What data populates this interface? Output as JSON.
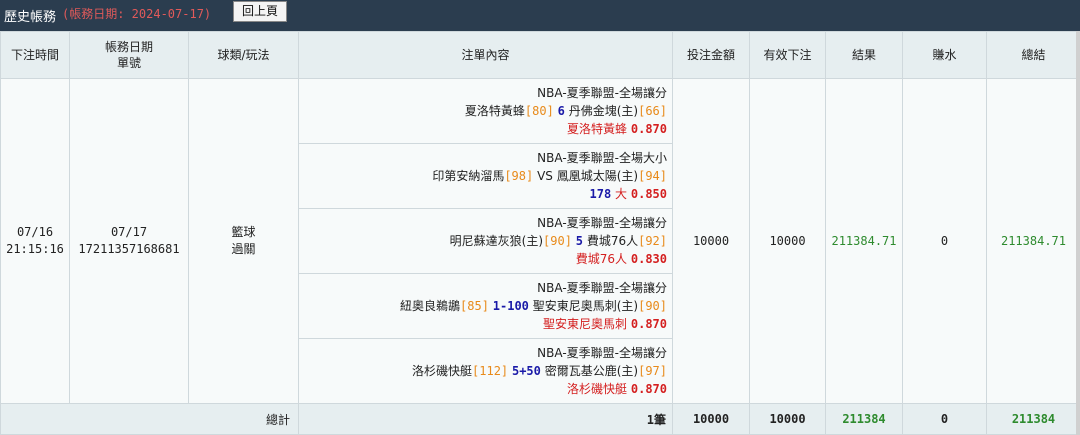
{
  "header": {
    "title": "歷史帳務",
    "date_label": "(帳務日期: 2024-07-17)",
    "back_button": "回上頁"
  },
  "columns": [
    "下注時間",
    "帳務日期",
    "單號",
    "球類/玩法",
    "注單內容",
    "投注金額",
    "有效下注",
    "結果",
    "賺水",
    "總結"
  ],
  "record": {
    "bet_date": "07/16",
    "bet_time": "21:15:16",
    "account_date": "07/17",
    "ticket_no": "17211357168681",
    "sport": "籃球",
    "play_type": "過關",
    "stake": "10000",
    "valid_stake": "10000",
    "result": "211384.71",
    "rebate": "0",
    "total": "211384.71",
    "legs": [
      {
        "league": "NBA-夏季聯盟-全場讓分",
        "team_a": "夏洛特黃蜂",
        "odds_a": "[80]",
        "line": "6",
        "sep": "",
        "team_b": "丹佛金塊(主)",
        "odds_b": "[66]",
        "pick_line": "",
        "pick": "夏洛特黃蜂",
        "price": "0.870"
      },
      {
        "league": "NBA-夏季聯盟-全場大小",
        "team_a": "印第安納溜馬",
        "odds_a": "[98]",
        "line": "",
        "sep": "VS",
        "team_b": "鳳凰城太陽(主)",
        "odds_b": "[94]",
        "pick_line": "178",
        "pick": "大",
        "price": "0.850"
      },
      {
        "league": "NBA-夏季聯盟-全場讓分",
        "team_a": "明尼蘇達灰狼(主)",
        "odds_a": "[90]",
        "line": "5",
        "sep": "",
        "team_b": "費城76人",
        "odds_b": "[92]",
        "pick_line": "",
        "pick": "費城76人",
        "price": "0.830"
      },
      {
        "league": "NBA-夏季聯盟-全場讓分",
        "team_a": "紐奧良鵜鶘",
        "odds_a": "[85]",
        "line": "1-100",
        "sep": "",
        "team_b": "聖安東尼奧馬刺(主)",
        "odds_b": "[90]",
        "pick_line": "",
        "pick": "聖安東尼奧馬刺",
        "price": "0.870"
      },
      {
        "league": "NBA-夏季聯盟-全場讓分",
        "team_a": "洛杉磯快艇",
        "odds_a": "[112]",
        "line": "5+50",
        "sep": "",
        "team_b": "密爾瓦基公鹿(主)",
        "odds_b": "[97]",
        "pick_line": "",
        "pick": "洛杉磯快艇",
        "price": "0.870"
      }
    ]
  },
  "totals": {
    "label": "總計",
    "count": "1筆",
    "stake": "10000",
    "valid_stake": "10000",
    "result": "211384",
    "rebate": "0",
    "total": "211384"
  },
  "colors": {
    "header_bg": "#2b3d4f",
    "table_header_bg": "#e6eef0",
    "odds_orange": "#e88a1a",
    "line_blue": "#1a1aa8",
    "pick_red": "#d42020",
    "win_green": "#2e8b2e"
  }
}
